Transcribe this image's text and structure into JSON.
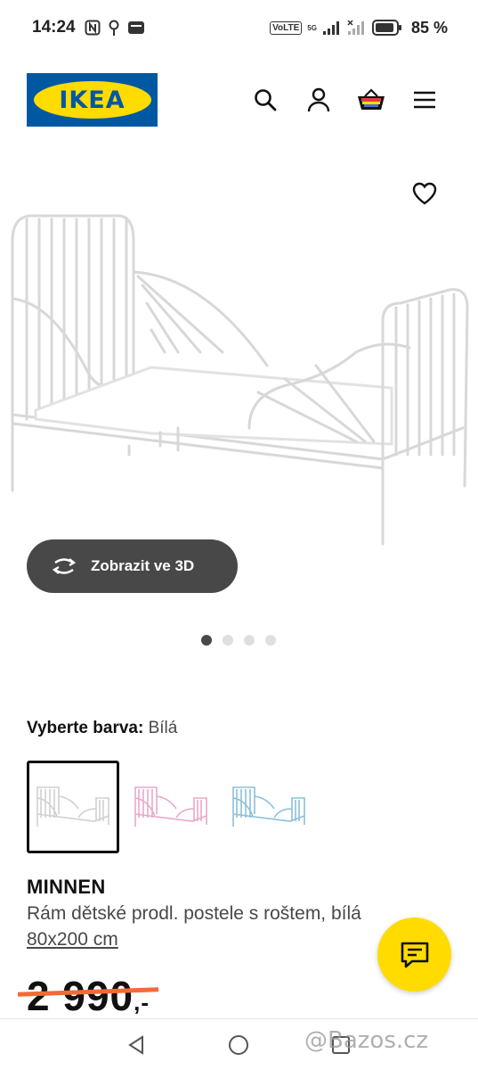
{
  "status_bar": {
    "time": "14:24",
    "volte": "VoLTE",
    "network": "5G",
    "battery": "85 %"
  },
  "header": {
    "logo_text": "IKEA",
    "icons": [
      "search-icon",
      "user-icon",
      "cart-icon",
      "menu-icon"
    ]
  },
  "gallery": {
    "view_3d_label": "Zobrazit ve 3D",
    "dots_total": 4,
    "dots_active": 1
  },
  "colors": {
    "label": "Vyberte barva:",
    "selected": "Bílá",
    "options": [
      "white",
      "pink",
      "light-blue"
    ]
  },
  "product": {
    "name": "MINNEN",
    "description": "Rám dětské prodl. postele s roštem, bílá",
    "size": "80x200 cm",
    "price": "2 990",
    "price_suffix": ",-"
  },
  "watermark": "@Bazos.cz",
  "theme": {
    "ikea_blue": "#0058a3",
    "ikea_yellow": "#ffdb00",
    "dark_button": "#484848",
    "strike_color": "#f26a36"
  }
}
